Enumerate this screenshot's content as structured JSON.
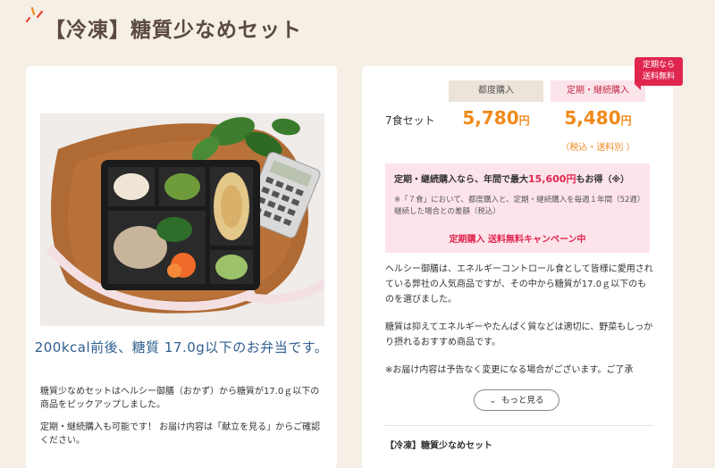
{
  "page": {
    "title": "【冷凍】糖質少なめセット"
  },
  "left_card": {
    "photo_alt": "product-photo",
    "tagline": "200kcal前後、糖質 17.0g以下のお弁当です。",
    "description_1": "糖質少なめセットはヘルシー御膳（おかず）から糖質が17.0ｇ以下の商品をピックアップしました。",
    "description_2": "定期・継続購入も可能です！ お届け内容は「献立を見る」からご確認ください。"
  },
  "pricing": {
    "ribbon": [
      "定期なら",
      "送料無料"
    ],
    "header_once": "都度購入",
    "header_subscription": "定期・継続購入",
    "set_label": "7食セット",
    "price_once": "5,780",
    "price_subscription": "5,480",
    "currency": "円",
    "tax_note": "（税込・送料別 ）"
  },
  "promo": {
    "main_prefix": "定期・継続購入なら、年間で最大",
    "main_amount": "15,600円",
    "main_suffix": "もお得（※）",
    "note": "※「７食」において、都度購入と、定期・継続購入を毎週１年間（52週）継続した場合との差額（税込）",
    "campaign": "定期購入 送料無料キャンペーン中"
  },
  "body": {
    "paragraph_1": "ヘルシー御膳は、エネルギーコントロール食として皆様に愛用されている弊社の人気商品ですが、その中から糖質が17.0ｇ以下のものを選びました。",
    "paragraph_2": "糖質は抑えてエネルギーやたんぱく質などは適切に、野菜もしっかり摂れるおすすめ商品です。",
    "paragraph_3": "※お届け内容は予告なく変更になる場合がございます。ご了承",
    "more_button": "もっと見る",
    "product_name": "【冷凍】糖質少なめセット"
  },
  "colors": {
    "accent_orange": "#f08a1c",
    "accent_pink": "#e0264f",
    "background": "#f5efe6"
  }
}
